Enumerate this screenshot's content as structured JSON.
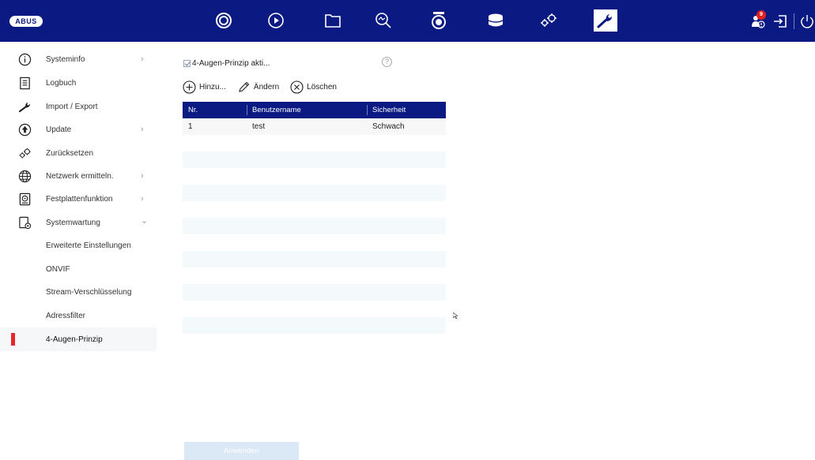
{
  "brand": {
    "logo_text": "ABUS"
  },
  "topnav": {
    "items": [
      {
        "name": "live-view-icon"
      },
      {
        "name": "playback-icon"
      },
      {
        "name": "file-manager-icon"
      },
      {
        "name": "smart-search-icon"
      },
      {
        "name": "camera-icon"
      },
      {
        "name": "storage-icon"
      },
      {
        "name": "configuration-icon"
      },
      {
        "name": "maintenance-icon",
        "active": true
      }
    ],
    "right_items": [
      {
        "name": "user-alert-icon",
        "badge": "9"
      },
      {
        "name": "logout-icon"
      },
      {
        "name": "power-icon"
      }
    ]
  },
  "sidebar": {
    "items": [
      {
        "label": "Systeminfo",
        "icon": "info-icon",
        "arrow": "›"
      },
      {
        "label": "Logbuch",
        "icon": "logbook-icon"
      },
      {
        "label": "Import / Export",
        "icon": "wrench-icon"
      },
      {
        "label": "Update",
        "icon": "update-icon",
        "arrow": "›"
      },
      {
        "label": "Zurücksetzen",
        "icon": "reset-icon"
      },
      {
        "label": "Netzwerk ermitteln.",
        "icon": "network-icon",
        "arrow": "›"
      },
      {
        "label": "Festplattenfunktion",
        "icon": "hdd-icon",
        "arrow": "›"
      },
      {
        "label": "Systemwartung",
        "icon": "system-maintenance-icon",
        "arrow": "⌄"
      },
      {
        "label": "Erweiterte Einstellungen"
      },
      {
        "label": "ONVIF"
      },
      {
        "label": "Stream-Verschlüsselung"
      },
      {
        "label": "Adressfilter"
      },
      {
        "label": "4-Augen-Prinzip",
        "selected": true
      }
    ]
  },
  "main": {
    "checkbox_label": "4-Augen-Prinzip akti...",
    "help": "?",
    "toolbar": {
      "add_label": "Hinzu...",
      "edit_label": "Ändern",
      "delete_label": "Löschen"
    },
    "table": {
      "headers": [
        "Nr.",
        "Benutzername",
        "Sicherheit"
      ],
      "rows": [
        [
          "1",
          "test",
          "Schwach"
        ]
      ]
    },
    "apply_label": "Anwenden"
  },
  "colors": {
    "topbar": "#0a1a82",
    "selected_marker": "#e8252c",
    "apply_button": "#dbe9f7"
  }
}
